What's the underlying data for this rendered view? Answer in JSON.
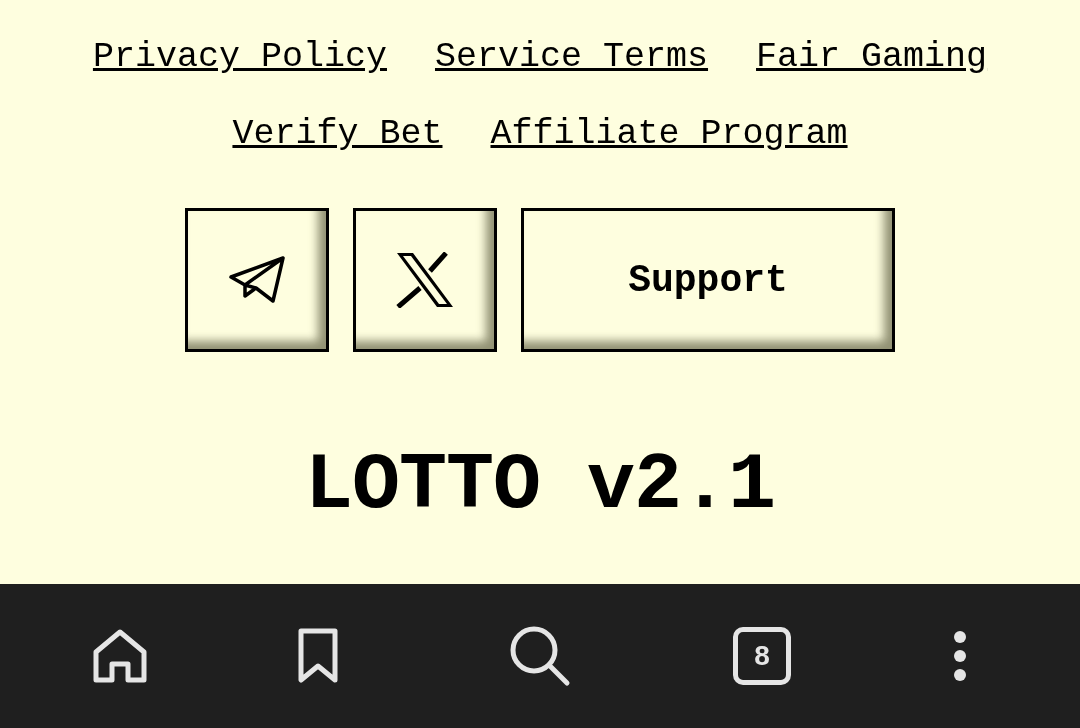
{
  "footer_links": [
    [
      "Privacy Policy",
      "Service Terms",
      "Fair Gaming"
    ],
    [
      "Verify Bet",
      "Affiliate Program"
    ]
  ],
  "social_buttons": [
    {
      "kind": "telegram"
    },
    {
      "kind": "x"
    }
  ],
  "support_button": {
    "label": "Support"
  },
  "title": "LOTTO v2.1",
  "bottom_nav": [
    {
      "kind": "home"
    },
    {
      "kind": "bookmark"
    },
    {
      "kind": "search"
    },
    {
      "kind": "tabs",
      "count": "8"
    },
    {
      "kind": "menu"
    }
  ]
}
